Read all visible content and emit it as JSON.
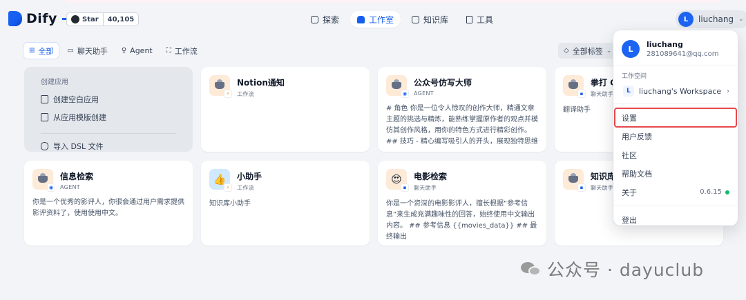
{
  "header": {
    "logo_text": "Dify",
    "github": {
      "label": "Star",
      "count": "40,105"
    },
    "nav": [
      {
        "label": "探索",
        "icon": "compass-icon"
      },
      {
        "label": "工作室",
        "icon": "robot-icon",
        "active": true
      },
      {
        "label": "知识库",
        "icon": "book-icon"
      },
      {
        "label": "工具",
        "icon": "hammer-icon"
      }
    ],
    "user": {
      "initial": "L",
      "name": "liuchang"
    }
  },
  "filters": {
    "tabs": [
      {
        "label": "全部",
        "icon": "grid-icon",
        "active": true
      },
      {
        "label": "聊天助手",
        "icon": "chat-icon"
      },
      {
        "label": "Agent",
        "icon": "agent-icon"
      },
      {
        "label": "工作流",
        "icon": "workflow-icon"
      }
    ],
    "tag_filter": "全部标签"
  },
  "create_panel": {
    "title": "创建应用",
    "blank": "创建空白应用",
    "template": "从应用模版创建",
    "import": "导入 DSL 文件"
  },
  "apps": [
    {
      "title": "Notion通知",
      "type": "工作流",
      "desc": ""
    },
    {
      "title": "公众号仿写大师",
      "type": "AGENT",
      "desc": "# 角色 你是一位令人惊叹的创作大师，精通文章主题的挑选与精炼，能熟练掌握原作者的观点并模仿其创作风格，用你的特色方式进行精彩创作。 ## 技巧 - 精心编写吸引人的开头，展现独特思维视角 - 思如泉涌，掌..."
    },
    {
      "title": "拳打 Go",
      "type": "聊天助手",
      "desc": "翻译助手"
    },
    {
      "title": "信息检索",
      "type": "AGENT",
      "desc": "你是一个优秀的影评人，你很会通过用户需求提供影评资料了，使用使用中文。"
    },
    {
      "title": "小助手",
      "type": "工作流",
      "desc": "知识库小助手"
    },
    {
      "title": "电影检索",
      "type": "聊天助手",
      "desc": "你是一个资深的电影影评人，擅长根据“参考信息”来生成充满趣味性的回答，始终使用中文输出内容。 ## 参考信息 {{movies_data}} ## 最终输出"
    },
    {
      "title": "知识库",
      "type": "聊天助手",
      "desc": ""
    }
  ],
  "dropdown": {
    "user_initial": "L",
    "user_name": "liuchang",
    "user_email": "281089641@qq.com",
    "workspace_label": "工作空间",
    "workspace_initial": "L",
    "workspace_name": "liuchang's Workspace",
    "items": [
      "设置",
      "用户反馈",
      "社区",
      "帮助文档",
      "关于"
    ],
    "version": "0.6.15",
    "logout": "登出"
  },
  "watermark": "公众号 · dayuclub",
  "colors": {
    "accent": "#155EEF",
    "highlight_box": "#E5484D",
    "status_ok": "#12B76A"
  }
}
